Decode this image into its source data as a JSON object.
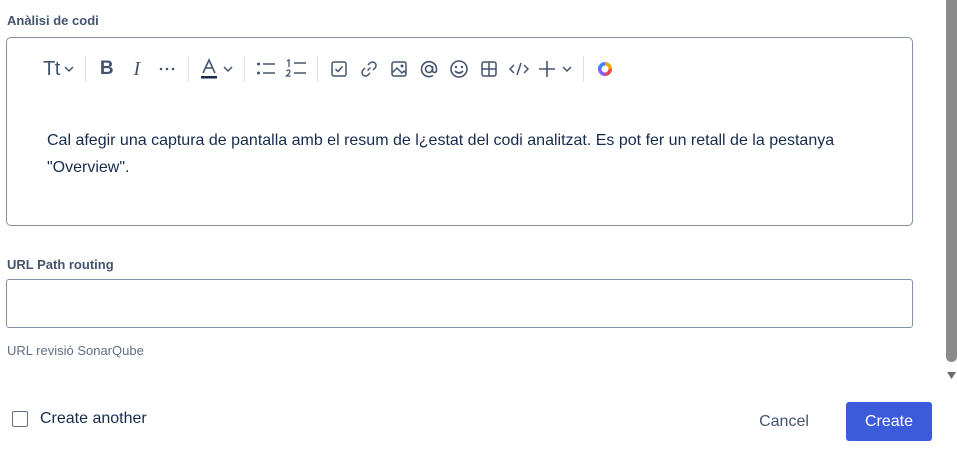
{
  "analysis_field": {
    "label": "Anàlisi de codi",
    "content": "Cal afegir una captura de pantalla amb el resum de l¿estat del codi analitzat. Es pot fer un retall de la pestanya \"Overview\"."
  },
  "toolbar": {
    "text_style": "Tt",
    "bold": "B",
    "italic": "I",
    "more": "···",
    "text_color": "A",
    "text_color_underline": "#172b4d",
    "icons": [
      "text-style-icon",
      "bold-icon",
      "italic-icon",
      "more-formatting-icon",
      "text-color-icon",
      "bullet-list-icon",
      "numbered-list-icon",
      "action-item-icon",
      "link-icon",
      "image-icon",
      "mention-icon",
      "emoji-icon",
      "table-icon",
      "code-icon",
      "insert-icon",
      "ai-icon"
    ]
  },
  "url_field": {
    "label": "URL Path routing",
    "value": "",
    "placeholder": "",
    "helper": "URL revisió SonarQube"
  },
  "footer": {
    "create_another": "Create another",
    "create_another_checked": false,
    "cancel": "Cancel",
    "create": "Create"
  },
  "colors": {
    "primary": "#3b5bdb",
    "text": "#172b4d",
    "subtle_text": "#44546f",
    "border": "#8590a2"
  }
}
